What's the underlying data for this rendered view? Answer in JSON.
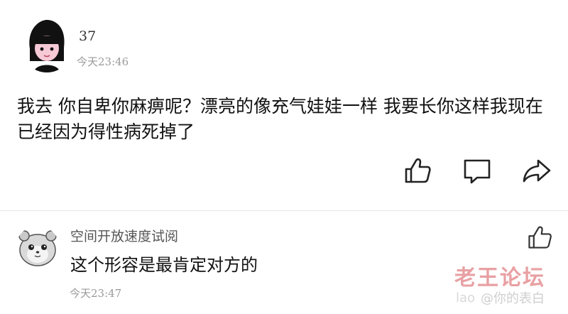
{
  "post": {
    "avatar_icon": "girl-avatar-icon",
    "username": "37",
    "time": "今天23:46",
    "text": "我去 你自卑你麻痹呢？漂亮的像充气娃娃一样 我要长你这样我现在已经因为得性病死掉了",
    "actions": {
      "like_icon": "thumbs-up-icon",
      "comment_icon": "comment-icon",
      "share_icon": "share-icon"
    }
  },
  "reply": {
    "avatar_icon": "hamster-avatar-icon",
    "username": "空间开放速度试阅",
    "text": "这个形容是最肯定对方的",
    "time": "今天23:47",
    "like_icon": "thumbs-up-icon"
  },
  "watermark": {
    "title": "老王论坛",
    "url_prefix": "lao",
    "weibo": "@你的表白"
  },
  "colors": {
    "text": "#111111",
    "muted": "#9a9a9a",
    "avatar_bg": "#f2d6e0",
    "watermark": "#e8a0a3"
  }
}
